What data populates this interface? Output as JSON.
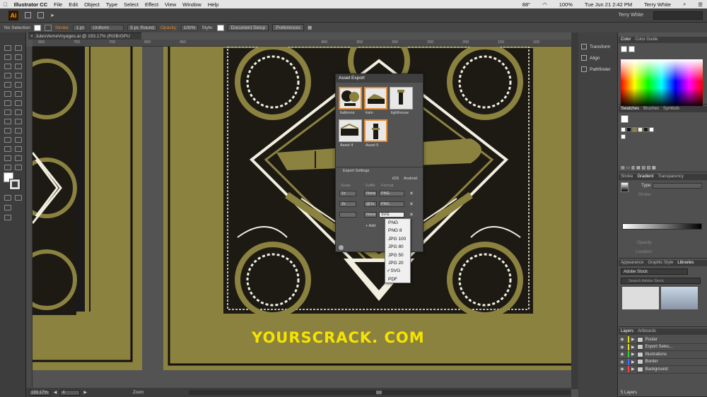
{
  "menubar": {
    "app_name": "Illustrator CC",
    "items": [
      "File",
      "Edit",
      "Object",
      "Type",
      "Select",
      "Effect",
      "View",
      "Window",
      "Help"
    ],
    "battery": "88°",
    "battery_pct": "100%",
    "datetime": "Tue Jun 21  2:42 PM",
    "user": "Terry White"
  },
  "appbar": {
    "logo": "Ai",
    "workspace_user": "Terry White"
  },
  "control": {
    "selection": "No Selection",
    "stroke_label": "Stroke:",
    "stroke_val": "1 pt",
    "uniform": "Uniform",
    "brush": "5 pt. Round",
    "opacity_label": "Opacity:",
    "opacity_val": "100%",
    "style_label": "Style:",
    "doc_setup": "Document Setup",
    "prefs": "Preferences"
  },
  "doc_tab": {
    "title": "JulesVerneVoyages.ai @ 193.17% (RGB/GPU Preview)"
  },
  "ruler": {
    "marks": [
      "800",
      "750",
      "700",
      "650",
      "450",
      "400",
      "350",
      "300",
      "250",
      "200",
      "150",
      "100",
      "50",
      "0",
      "50"
    ]
  },
  "asset_export": {
    "title": "Asset Export",
    "assets": [
      "balloons",
      "train",
      "lighthouse",
      "Asset 4",
      "Asset 5"
    ],
    "settings_label": "Export Settings",
    "ios": "iOS",
    "android": "Android",
    "col_scale": "Scale",
    "col_suffix": "Suffix",
    "col_format": "Format",
    "rows": [
      {
        "scale": "1x",
        "suffix": "None",
        "format": "PNG"
      },
      {
        "scale": "2x",
        "suffix": "@2x",
        "format": "PNG"
      },
      {
        "scale": "",
        "suffix": "None",
        "format": "SVG"
      }
    ],
    "add_scale": "+ Add"
  },
  "format_menu": {
    "options": [
      "PNG",
      "PNG 8",
      "JPG 100",
      "JPG 80",
      "JPG 50",
      "JPG 20",
      "SVG",
      "PDF"
    ],
    "selected": "SVG"
  },
  "panels_icons": {
    "items": [
      "Transform",
      "Align",
      "Pathfinder"
    ]
  },
  "color_panel": {
    "tabs": [
      "Color",
      "Color Guide"
    ]
  },
  "swatches_panel": {
    "tabs": [
      "Swatches",
      "Brushes",
      "Symbols"
    ]
  },
  "gradient_panel": {
    "tabs": [
      "Stroke",
      "Gradient",
      "Transparency"
    ],
    "type_label": "Type:",
    "stroke_label": "Stroke:",
    "opacity_label": "Opacity:",
    "location_label": "Location:"
  },
  "libraries_panel": {
    "tabs": [
      "Appearance",
      "Graphic Style",
      "Libraries"
    ],
    "library": "Adobe Stock",
    "search_placeholder": "Search Adobe Stock"
  },
  "layers_panel": {
    "tabs": [
      "Layers",
      "Artboards"
    ],
    "layers": [
      {
        "name": "Poster",
        "color": "#e0e000"
      },
      {
        "name": "Export Selec...",
        "color": "#e0e000"
      },
      {
        "name": "Illustrations",
        "color": "#3cc63c"
      },
      {
        "name": "Border",
        "color": "#3c6cff"
      },
      {
        "name": "Background",
        "color": "#ff3c3c"
      }
    ],
    "count": "5 Layers"
  },
  "status": {
    "zoom": "193.17%",
    "artboard": "4",
    "tool": "Zoom"
  },
  "watermark": "YOURSCRACK. COM"
}
